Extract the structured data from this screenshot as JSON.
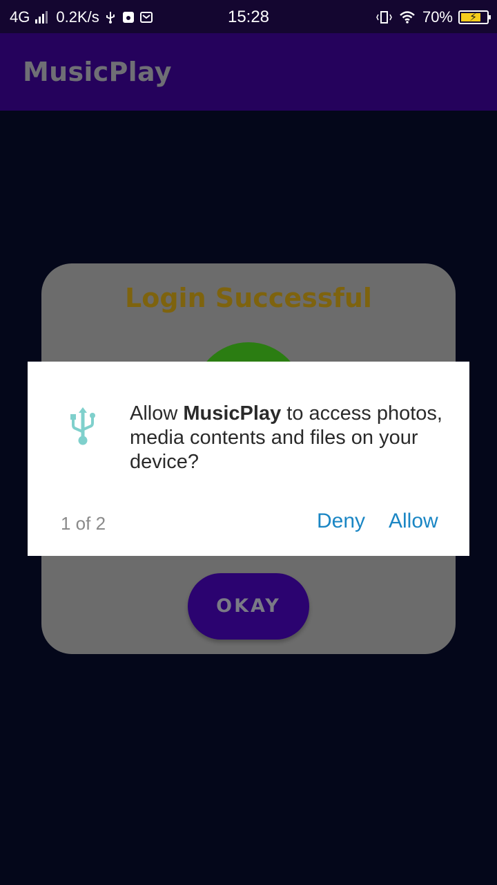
{
  "status_bar": {
    "network": "4G",
    "speed": "0.2K/s",
    "time": "15:28",
    "battery": "70%",
    "battery_level": 0.7,
    "icons": [
      "usb-icon",
      "settings-icon",
      "mail-icon",
      "vibrate-icon",
      "wifi-icon",
      "battery-icon"
    ]
  },
  "app_bar": {
    "title": "MusicPlay"
  },
  "card": {
    "title": "Login Successful",
    "button": "OKAY"
  },
  "dialog": {
    "icon": "usb-icon",
    "msg_prefix": "Allow ",
    "app_name": "MusicPlay",
    "msg_suffix": " to access photos, media contents and files on your device?",
    "page_count": "1 of 2",
    "deny": "Deny",
    "allow": "Allow"
  },
  "colors": {
    "status_bar": "#140630",
    "app_bar": "#25025c",
    "background": "#04071a",
    "card": "#6c6c6c",
    "card_title": "#7e630e",
    "success_circle": "#2b7d12",
    "okay_button": "#2b0370",
    "accent": "#1a86c4",
    "usb_icon": "#7fd0cc"
  }
}
